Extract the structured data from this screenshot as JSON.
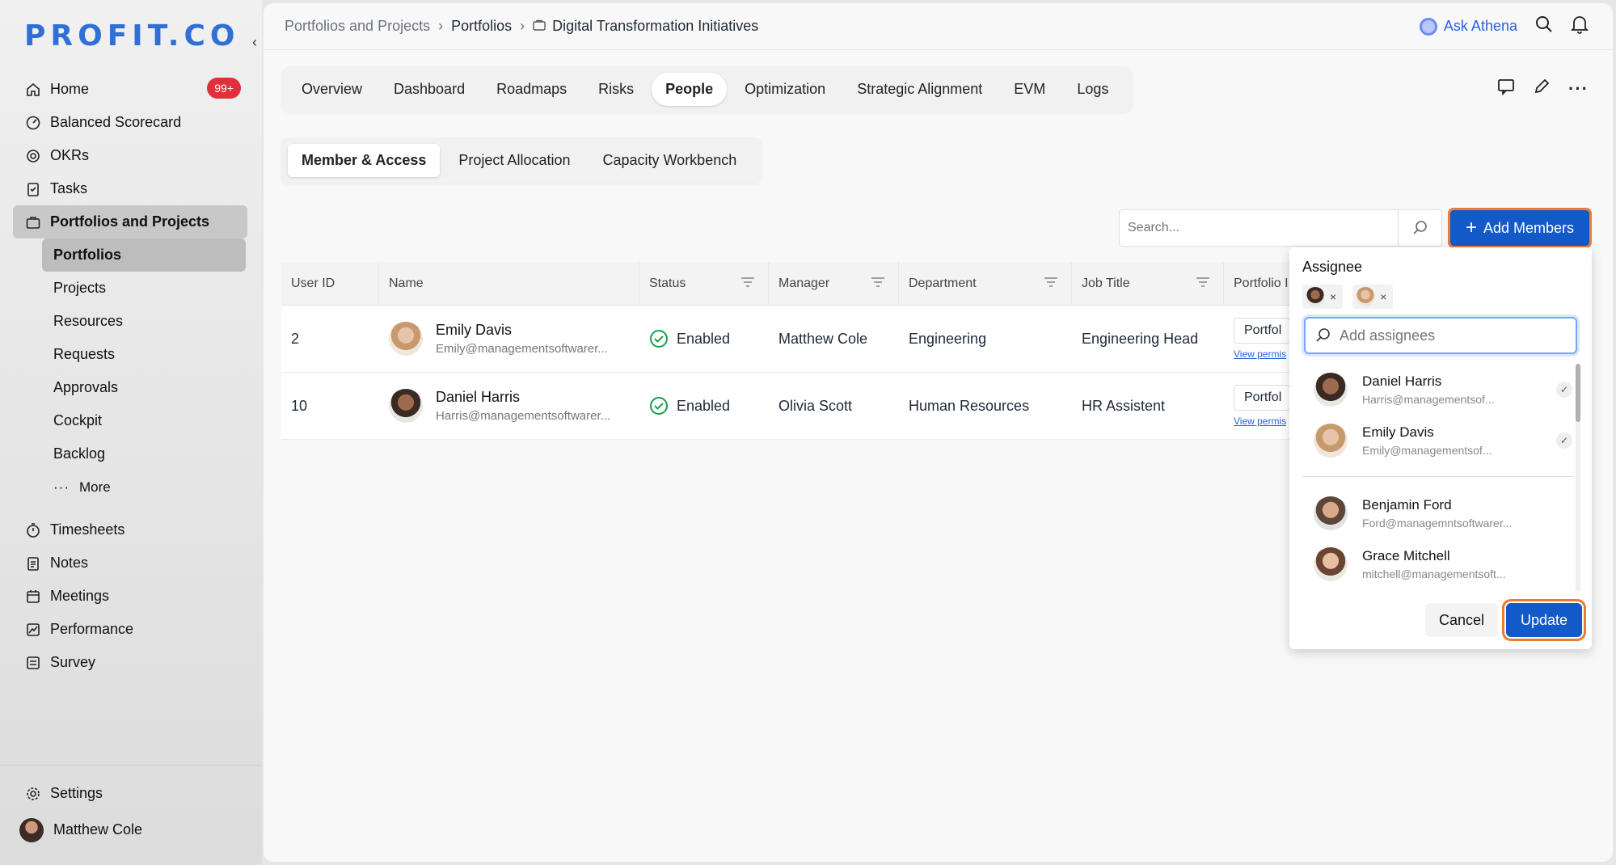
{
  "app": {
    "logo": "PROFIT.CO"
  },
  "sidebar": {
    "home_badge": "99+",
    "items": [
      {
        "label": "Home",
        "icon": "home-icon"
      },
      {
        "label": "Balanced Scorecard",
        "icon": "scorecard-icon"
      },
      {
        "label": "OKRs",
        "icon": "target-icon"
      },
      {
        "label": "Tasks",
        "icon": "clipboard-icon"
      },
      {
        "label": "Portfolios and Projects",
        "icon": "briefcase-icon"
      }
    ],
    "sub_items": [
      "Portfolios",
      "Projects",
      "Resources",
      "Requests",
      "Approvals",
      "Cockpit",
      "Backlog",
      "More"
    ],
    "items2": [
      {
        "label": "Timesheets",
        "icon": "stopwatch-icon"
      },
      {
        "label": "Notes",
        "icon": "notes-icon"
      },
      {
        "label": "Meetings",
        "icon": "calendar-icon"
      },
      {
        "label": "Performance",
        "icon": "chart-icon"
      },
      {
        "label": "Survey",
        "icon": "survey-icon"
      }
    ],
    "settings": "Settings",
    "user": "Matthew Cole"
  },
  "breadcrumb": {
    "root": "Portfolios and Projects",
    "mid": "Portfolios",
    "current": "Digital Transformation Initiatives"
  },
  "topbar": {
    "ask_athena": "Ask Athena"
  },
  "tabs": [
    "Overview",
    "Dashboard",
    "Roadmaps",
    "Risks",
    "People",
    "Optimization",
    "Strategic Alignment",
    "EVM",
    "Logs"
  ],
  "subtabs": [
    "Member & Access",
    "Project Allocation",
    "Capacity Workbench"
  ],
  "search": {
    "placeholder": "Search..."
  },
  "add_members": "Add Members",
  "table": {
    "headers": [
      "User ID",
      "Name",
      "Status",
      "Manager",
      "Department",
      "Job Title",
      "Portfolio I"
    ],
    "rows": [
      {
        "id": "2",
        "name": "Emily Davis",
        "email": "Emily@managementsoftwarer...",
        "status": "Enabled",
        "manager": "Matthew Cole",
        "department": "Engineering",
        "job": "Engineering Head",
        "portfolio": "Portfol",
        "view": "View permis"
      },
      {
        "id": "10",
        "name": "Daniel Harris",
        "email": "Harris@managementsoftwarer...",
        "status": "Enabled",
        "manager": "Olivia Scott",
        "department": "Human Resources",
        "job": "HR Assistent",
        "portfolio": "Portfol",
        "view": "View permis"
      }
    ]
  },
  "assignee": {
    "title": "Assignee",
    "chip_close": "×",
    "placeholder": "Add assignees",
    "selected": [
      {
        "name": "Daniel Harris",
        "email": "Harris@managementsof..."
      },
      {
        "name": "Emily Davis",
        "email": "Emily@managementsof..."
      }
    ],
    "others": [
      {
        "name": "Benjamin Ford",
        "email": "Ford@managemntsoftwarer..."
      },
      {
        "name": "Grace Mitchell",
        "email": "mitchell@managementsoft..."
      }
    ],
    "cancel": "Cancel",
    "update": "Update"
  },
  "colors": {
    "accent": "#1459c8",
    "highlight": "#ef7a32",
    "badge": "#e0303b",
    "success": "#1a9e4b"
  }
}
